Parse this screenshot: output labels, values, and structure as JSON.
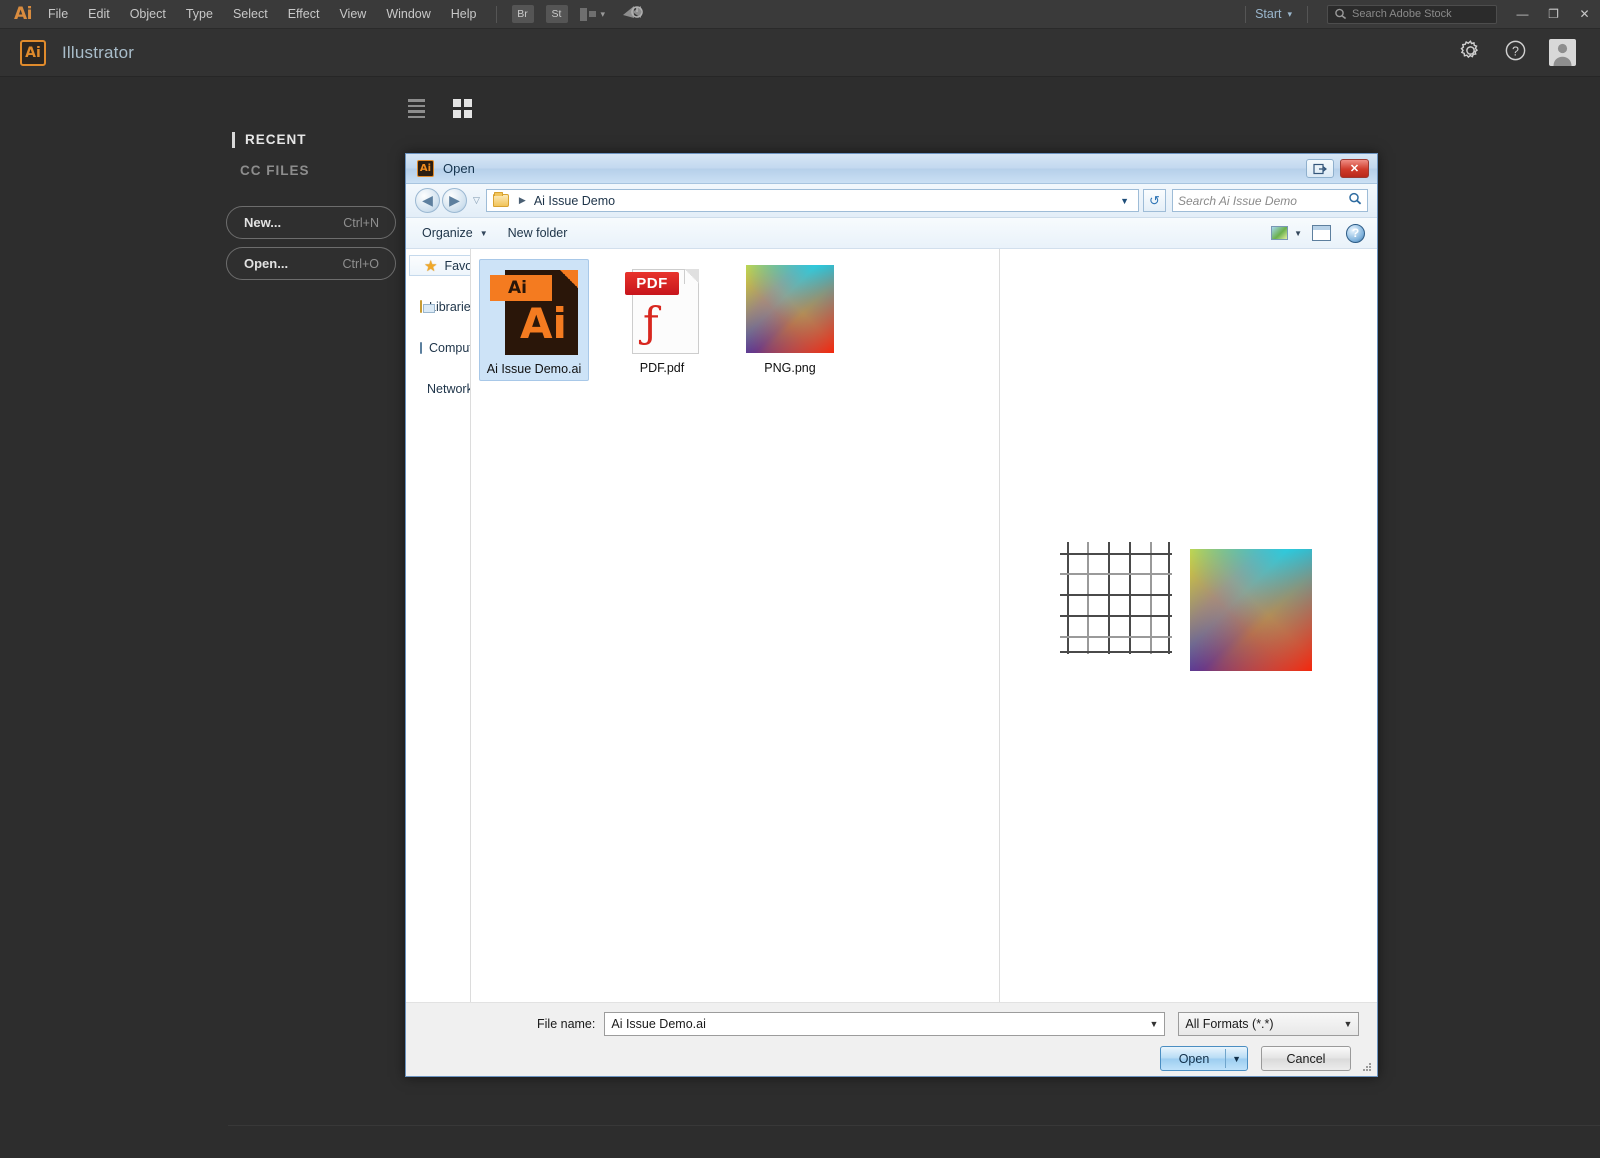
{
  "menubar": {
    "logo": "Ai",
    "items": [
      "File",
      "Edit",
      "Object",
      "Type",
      "Select",
      "Effect",
      "View",
      "Window",
      "Help"
    ],
    "bridge_label": "Br",
    "stock_label": "St",
    "arrange_icon": "arrange-documents-icon",
    "chevron": "▾",
    "sync_icon": "sync-settings-icon",
    "start_label": "Start",
    "start_chevron": "▾",
    "search_placeholder": "Search Adobe Stock",
    "search_icon": "search-icon",
    "minimize": "—",
    "maximize": "❐",
    "close": "✕"
  },
  "appbar": {
    "badge": "Ai",
    "title": "Illustrator",
    "gear_icon": "gear-icon",
    "help_icon": "help-icon",
    "avatar_icon": "user-avatar-icon"
  },
  "workspace": {
    "view_list_icon": "list-view-icon",
    "view_grid_icon": "grid-view-icon",
    "recent_label": "RECENT",
    "ccfiles_label": "CC FILES",
    "buttons": [
      {
        "label": "New...",
        "shortcut": "Ctrl+N"
      },
      {
        "label": "Open...",
        "shortcut": "Ctrl+O"
      }
    ]
  },
  "dialog": {
    "icon": "Ai",
    "title": "Open",
    "restore_icon": "restore-window-icon",
    "close_icon": "close-window-icon",
    "close_glyph": "✕",
    "nav": {
      "back_icon": "back-arrow-icon",
      "back_glyph": "◀",
      "forward_icon": "forward-arrow-icon",
      "forward_glyph": "▶",
      "history_chevron": "▽",
      "folder_icon": "folder-icon",
      "crumb_arrow": "▶",
      "breadcrumb": "Ai Issue Demo",
      "address_dropdown": "▼",
      "refresh_icon": "refresh-icon",
      "refresh_glyph": "↺",
      "search_placeholder": "Search Ai Issue Demo",
      "search_icon": "search-icon",
      "search_glyph": "⌕"
    },
    "commandbar": {
      "organize_label": "Organize",
      "organize_caret": "▼",
      "newfolder_label": "New folder",
      "views_icon": "change-view-icon",
      "views_caret": "▼",
      "preview_pane_icon": "preview-pane-icon",
      "help_icon": "help-icon",
      "help_glyph": "?"
    },
    "navpane": [
      {
        "label": "Favorites",
        "icon": "favorites-star-icon",
        "selected": true
      },
      {
        "label": "Libraries",
        "icon": "libraries-icon",
        "selected": false
      },
      {
        "label": "Computer",
        "icon": "computer-icon",
        "selected": false
      },
      {
        "label": "Network",
        "icon": "network-icon",
        "selected": false
      }
    ],
    "files": [
      {
        "name": "Ai Issue Demo.ai",
        "type": "ai",
        "selected": true,
        "badge": "Ai",
        "glyph": "Ai"
      },
      {
        "name": "PDF.pdf",
        "type": "pdf",
        "selected": false,
        "badge": "PDF",
        "glyph": "ƒ"
      },
      {
        "name": "PNG.png",
        "type": "png",
        "selected": false,
        "badge": "",
        "glyph": ""
      }
    ],
    "preview": {
      "grid_icon": "artwork-grid-preview",
      "gradient_icon": "artwork-gradient-preview"
    },
    "footer": {
      "filename_label": "File name:",
      "filename_value": "Ai Issue Demo.ai",
      "filename_dropdown": "▼",
      "format_value": "All Formats (*.*)",
      "format_dropdown": "▼",
      "open_label": "Open",
      "open_caret": "▼",
      "cancel_label": "Cancel"
    }
  },
  "colors": {
    "accent_orange": "#e08b2c",
    "app_bg": "#2d2d2d",
    "dialog_bg": "#f0f0f0",
    "selection_blue": "#cde3f7"
  }
}
